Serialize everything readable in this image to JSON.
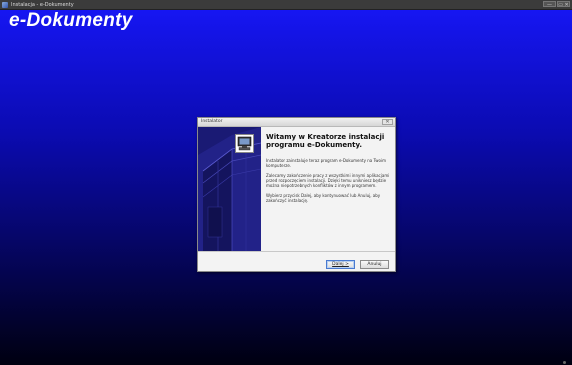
{
  "window": {
    "title": "Instalacja - e-Dokumenty",
    "minimize_label": "—",
    "restore_label": "▭ ✕"
  },
  "background": {
    "brand_title": "e-Dokumenty"
  },
  "dialog": {
    "title": "Instalator",
    "close_label": "✕",
    "heading": "Witamy w Kreatorze instalacji programu e-Dokumenty.",
    "paragraphs": [
      "Instalator zainstaluje teraz program e-Dokumenty na Twoim komputerze.",
      "Zalecamy zakończenie pracy z wszystkimi innymi aplikacjami przed rozpoczęciem instalacji. Dzięki temu unikniesz będzie można niepotrzebnych konfliktów z innym programem.",
      "Wybierz przycisk Dalej, aby kontynuować lub Anuluj, aby zakończyć instalację."
    ],
    "buttons": {
      "next": "Dalej >",
      "cancel": "Anuluj"
    }
  },
  "colors": {
    "background_top": "#1616f2",
    "background_bottom": "#000010",
    "side_panel": "#1a1a74"
  }
}
